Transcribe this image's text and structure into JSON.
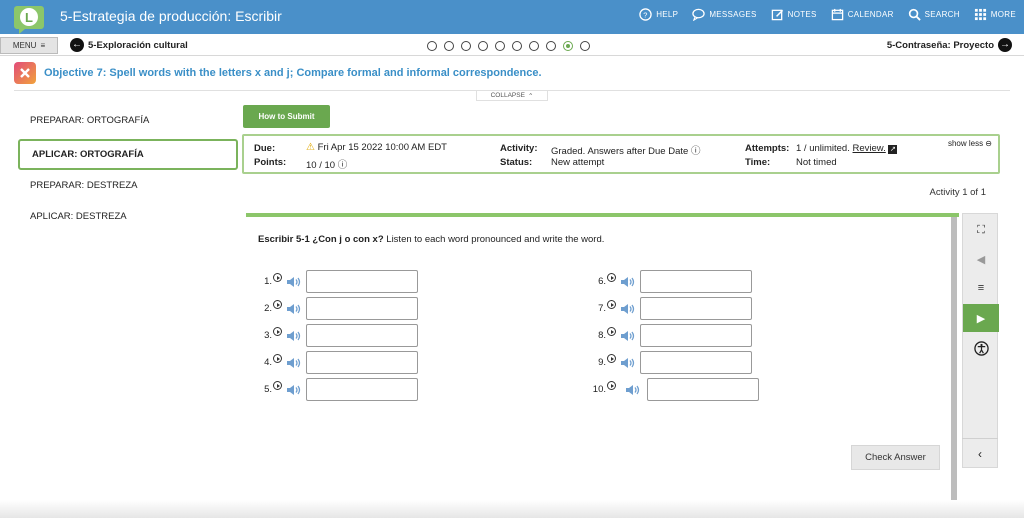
{
  "header": {
    "app_title": "5-Estrategia de producción: Escribir",
    "nav": [
      {
        "label": "HELP",
        "icon": "help-icon"
      },
      {
        "label": "MESSAGES",
        "icon": "messages-icon"
      },
      {
        "label": "NOTES",
        "icon": "notes-icon"
      },
      {
        "label": "CALENDAR",
        "icon": "calendar-icon"
      },
      {
        "label": "SEARCH",
        "icon": "search-icon"
      },
      {
        "label": "MORE",
        "icon": "grid-icon"
      }
    ],
    "brand_color": "#4a90c9"
  },
  "subbar": {
    "menu_label": "MENU",
    "prev_label": "5-Exploración cultural",
    "next_label": "5-Contraseña: Proyecto",
    "progress_total": 10,
    "progress_current": 9
  },
  "objective": {
    "text": "Objective 7: Spell words with the letters x and j; Compare formal and informal correspondence.",
    "collapse_label": "COLLAPSE"
  },
  "sidebar": {
    "items": [
      {
        "label": "PREPARAR: ORTOGRAFÍA",
        "active": false
      },
      {
        "label": "APLICAR: ORTOGRAFÍA",
        "active": true
      },
      {
        "label": "PREPARAR: DESTREZA",
        "active": false
      },
      {
        "label": "APLICAR: DESTREZA",
        "active": false
      }
    ]
  },
  "assignment": {
    "submit_label": "How to Submit",
    "due_label": "Due:",
    "due_value": "Fri Apr 15 2022 10:00 AM EDT",
    "points_label": "Points:",
    "points_value": "10 / 10",
    "activity_label": "Activity:",
    "activity_value": "Graded. Answers after Due Date",
    "status_label": "Status:",
    "status_value": "New attempt",
    "attempts_label": "Attempts:",
    "attempts_value": "1 / unlimited.",
    "review_label": "Review.",
    "time_label": "Time:",
    "time_value": "Not timed",
    "show_less_label": "show less",
    "activity_count": "Activity 1 of 1"
  },
  "exercise": {
    "title": "Escribir 5-1 ¿Con j o con x?",
    "instruction": "Listen to each word pronounced and write the word.",
    "items": [
      "1.",
      "2.",
      "3.",
      "4.",
      "5.",
      "6.",
      "7.",
      "8.",
      "9.",
      "10."
    ],
    "check_label": "Check Answer"
  },
  "accent_green": "#6aa84f"
}
